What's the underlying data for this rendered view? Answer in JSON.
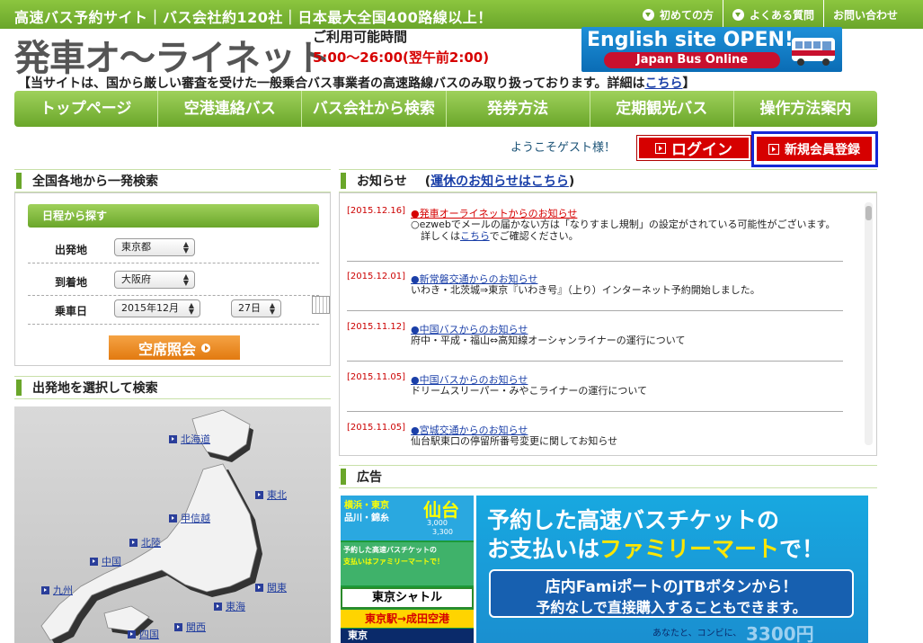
{
  "topbar": {
    "tagline": "高速バス予約サイト｜バス会社約120社｜日本最大全国400路線以上！",
    "links": [
      "初めての方",
      "よくある質問",
      "お問い合わせ"
    ]
  },
  "header": {
    "logo": "発車オ〜ライネット",
    "hours_label": "ご利用可能時間",
    "hours_time": "5:00〜26:00(翌午前2:00)",
    "english_banner_title": "English site OPEN!",
    "english_banner_sub": "Japan Bus Online",
    "notice_text": "【当サイトは、国から厳しい審査を受けた一般乗合バス事業者の高速路線バスのみ取り扱っております。詳細は",
    "notice_link": "こちら",
    "notice_end": "】"
  },
  "nav": [
    "トップページ",
    "空港連絡バス",
    "バス会社から検索",
    "発券方法",
    "定期観光バス",
    "操作方法案内"
  ],
  "account": {
    "welcome": "ようこそゲスト様！",
    "login": "ログイン",
    "register": "新規会員登録"
  },
  "search": {
    "title": "全国各地から一発検索",
    "sub_tab": "日程から探す",
    "from_label": "出発地",
    "from_value": "東京都",
    "to_label": "到着地",
    "to_value": "大阪府",
    "date_label": "乗車日",
    "month_value": "2015年12月",
    "day_value": "27日",
    "submit": "空席照会"
  },
  "map_panel": {
    "title": "出発地を選択して検索",
    "regions": [
      "北海道",
      "東北",
      "甲信越",
      "北陸",
      "中国",
      "関東",
      "九州",
      "東海",
      "関西",
      "四国"
    ]
  },
  "news": {
    "title": "お知らせ",
    "suffix_link": "運休のお知らせはこちら",
    "items": [
      {
        "date": "[2015.12.16]",
        "title": "●発車オーライネットからのお知らせ",
        "color": "#d60000",
        "body1": "○ezwebでメールの届かない方は「なりすまし規制」の設定がされている可能性がございます。",
        "body2_pre": "　詳しくは",
        "body2_link": "こちら",
        "body2_post": "でご確認ください。"
      },
      {
        "date": "[2015.12.01]",
        "title": "●新常磐交通からのお知らせ",
        "color": "#1a3fa8",
        "body1": "いわき・北茨城⇒東京『いわき号』（上り）インターネット予約開始しました。"
      },
      {
        "date": "[2015.11.12]",
        "title": "●中国バスからのお知らせ",
        "color": "#1a3fa8",
        "body1": "府中・平成・福山⇔高知線オーシャンライナーの運行について"
      },
      {
        "date": "[2015.11.05]",
        "title": "●中国バスからのお知らせ",
        "color": "#1a3fa8",
        "body1": "ドリームスリーパー・みやこライナーの運行について"
      },
      {
        "date": "[2015.11.05]",
        "title": "●宮城交通からのお知らせ",
        "color": "#1a3fa8",
        "body1": "仙台駅東口の停留所番号変更に関してお知らせ"
      }
    ]
  },
  "ads": {
    "title": "広告",
    "left": {
      "line1": "横浜・東京",
      "line2": "品川・錦糸",
      "city": "仙台",
      "price1": "3,000",
      "price2": "3,300",
      "mini1": "予約した高速バスチケットの",
      "mini2": "支払いはファミリーマートで！",
      "shuttle": "東京シャトル",
      "route": "東京駅→成田空港",
      "bottom": "東京"
    },
    "main": {
      "line1": "予約した高速バスチケットの",
      "line2_pre": "お支払いは",
      "line2_hl": "ファミリーマート",
      "line2_post": "で！",
      "box1": "店内Famiポートの",
      "box1b": "JTBボタンから！",
      "box2": "予約なしで直接購入することもできます。",
      "footer": "あなたと、コンビに、",
      "price": "3300円"
    }
  },
  "colors": {
    "brand_green": "#6aa62a",
    "red": "#d60000",
    "orange": "#e27a10",
    "blue_outline": "#1428d6"
  }
}
